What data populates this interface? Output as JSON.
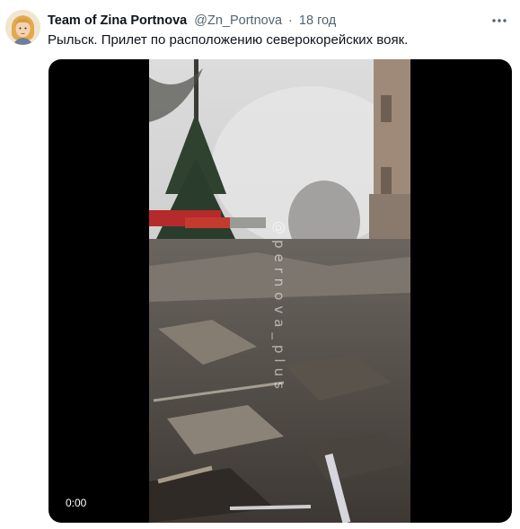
{
  "tweet": {
    "author": {
      "display_name": "Team of Zina Portnova",
      "handle": "@Zn_Portnova",
      "avatar_icon": "user-avatar-portrait"
    },
    "separator": "·",
    "timestamp": "18 год",
    "more_icon": "more-horizontal-icon",
    "text": "Рыльск. Прилет по расположению северокорейских вояк.",
    "media": {
      "type": "video",
      "current_time": "0:00",
      "watermark": "@pernova_plus"
    }
  },
  "colors": {
    "text_primary": "#0f1419",
    "text_secondary": "#536471",
    "media_background": "#000000",
    "page_background": "#ffffff"
  }
}
